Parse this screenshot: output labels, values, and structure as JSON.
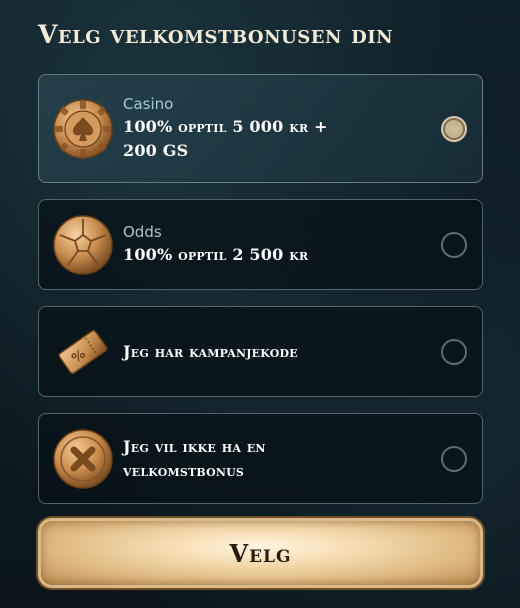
{
  "header": {
    "title": "Velg velkomstbonusen din"
  },
  "options": [
    {
      "category": "Casino",
      "line1": "100% opptil 5 000 kr +",
      "line2": "200 GS",
      "icon": "poker-chip-icon",
      "selected": true
    },
    {
      "category": "Odds",
      "line1": "100% opptil 2 500 kr",
      "icon": "football-icon",
      "selected": false
    },
    {
      "line1": "Jeg har kampanjekode",
      "icon": "coupon-ticket-icon",
      "selected": false
    },
    {
      "line1": "Jeg vil ikke ha en",
      "line2": "velkomstbonus",
      "icon": "cross-icon",
      "selected": false
    }
  ],
  "cta": {
    "label": "Velg"
  },
  "colors": {
    "gold": "#c9975a",
    "background": "#0b1a21",
    "border": "#55646a",
    "text": "#ffffff",
    "category_text": "#a9c7d2"
  }
}
